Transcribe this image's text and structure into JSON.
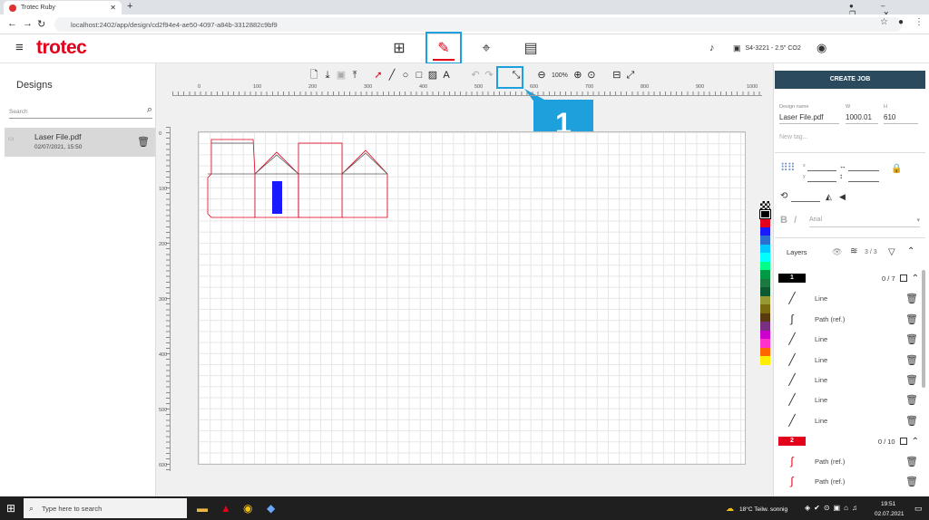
{
  "browser": {
    "tab_title": "Trotec Ruby",
    "url": "localhost:2402/app/design/cd2f94e4-ae50-4097-a84b-3312882c9bf9"
  },
  "app": {
    "logo": "trotec",
    "machine": "S4-3221 - 2.5\" CO2",
    "accent": "#e2001a",
    "callout": "#1ea0dc"
  },
  "left": {
    "title": "Designs",
    "search_placeholder": "Search",
    "file": {
      "name": "Laser File.pdf",
      "date": "02/07/2021, 15:50"
    }
  },
  "toolbar": {
    "zoom": "100%"
  },
  "badge": "1",
  "rulers": {
    "top": [
      "0",
      "100",
      "200",
      "300",
      "400",
      "500",
      "600",
      "700",
      "800",
      "900",
      "1000"
    ],
    "left": [
      "0",
      "100",
      "200",
      "300",
      "400",
      "500",
      "600"
    ]
  },
  "right": {
    "create_job": "CREATE JOB",
    "design_name_label": "Design name",
    "design_name": "Laser File.pdf",
    "w_label": "W",
    "w": "1000.01",
    "h_label": "H",
    "h": "610",
    "tag_placeholder": "New tag...",
    "x_label": "x",
    "y_label": "y",
    "font": "Arial",
    "layers_label": "Layers",
    "layers_count": "3 / 3",
    "layer1": {
      "num": "1",
      "count": "0 / 7",
      "color": "#000000"
    },
    "layer2": {
      "num": "2",
      "count": "0 / 10",
      "color": "#e2001a"
    },
    "items1": [
      "Line",
      "Path (ref.)",
      "Line",
      "Line",
      "Line",
      "Line",
      "Line"
    ],
    "items2": [
      "Path (ref.)",
      "Path (ref.)"
    ]
  },
  "palette": [
    "#000000",
    "#e2001a",
    "#1a1aff",
    "#2d6fd0",
    "#00c8ff",
    "#00ffff",
    "#00ff88",
    "#009944",
    "#1a7a40",
    "#0b5a30",
    "#999933",
    "#7a6a10",
    "#5a3a10",
    "#7a3080",
    "#cc00cc",
    "#ff33cc",
    "#ff6600",
    "#ffee00"
  ],
  "taskbar": {
    "search": "Type here to search",
    "weather": "18°C  Teilw. sonnig",
    "time": "19:51",
    "date": "02.07.2021"
  }
}
